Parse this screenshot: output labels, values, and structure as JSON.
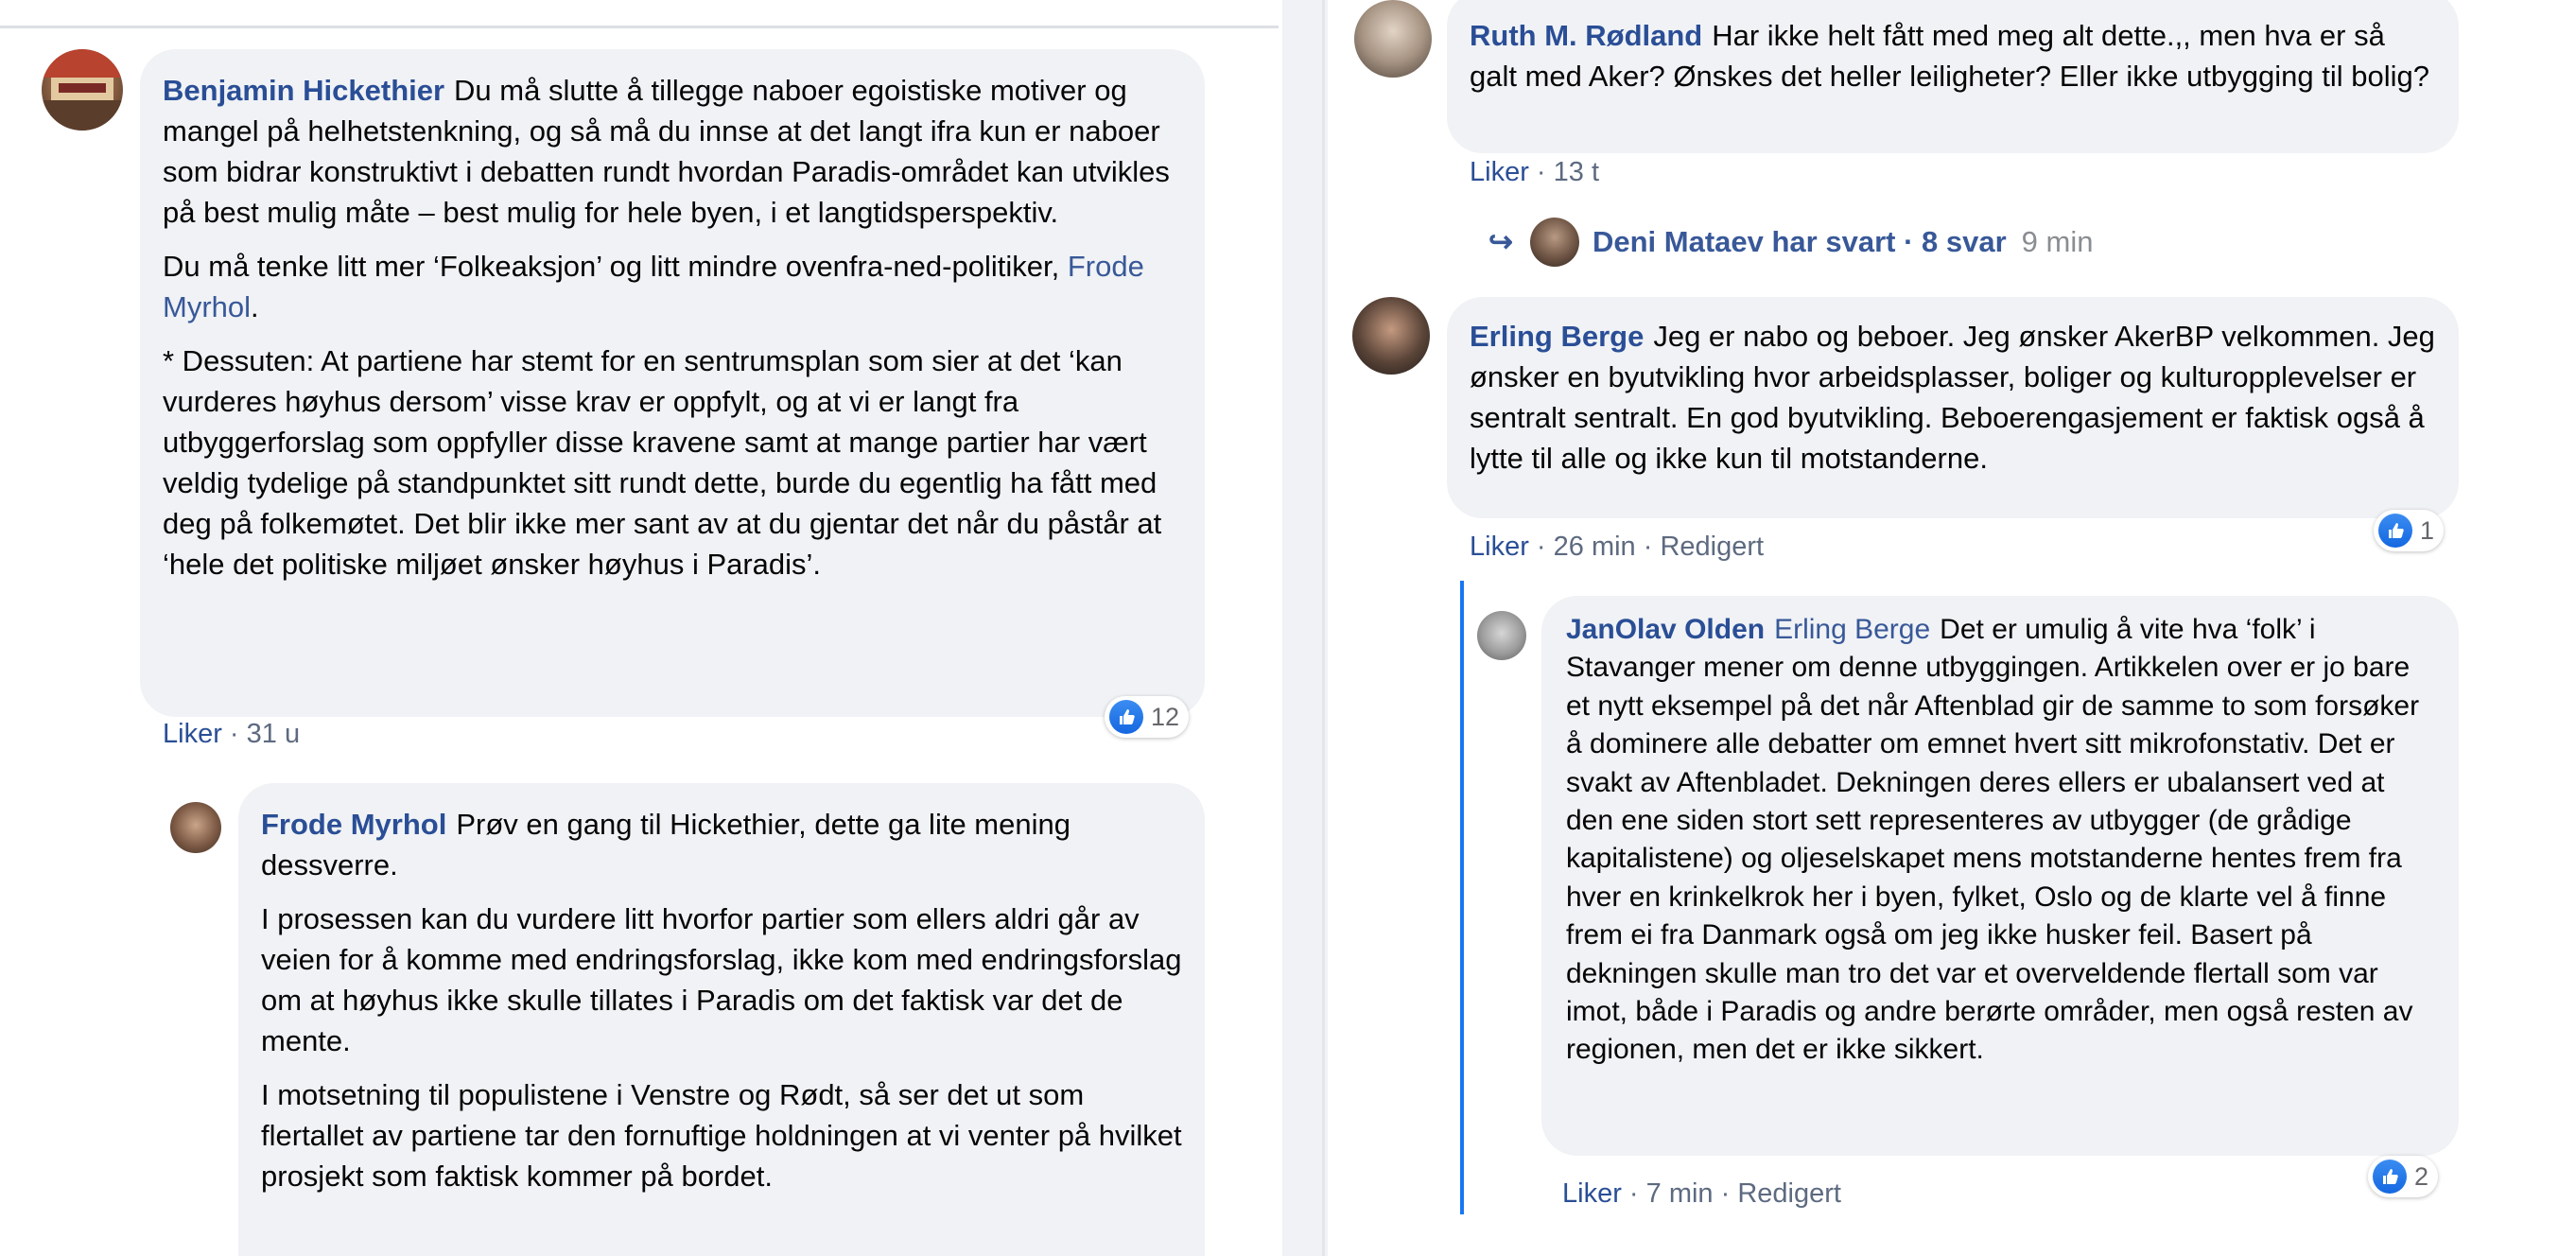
{
  "left": {
    "comment1": {
      "author": "Benjamin Hickethier",
      "para1": "Du må slutte å tillegge naboer egoistiske motiver og mangel på helhetstenkning, og så må du innse at det langt ifra kun er naboer som bidrar konstruktivt i debatten rundt hvordan Paradis-området kan utvikles på best mulig måte – best mulig for hele byen, i et langtidsperspektiv.",
      "para2_before": "Du må tenke litt mer ‘Folkeaksjon’ og litt mindre ovenfra-ned-politiker,",
      "para2_mention": "Frode Myrhol",
      "para2_after": ".",
      "para3": "* Dessuten: At partiene har stemt for en sentrumsplan som sier at det ‘kan vurderes høyhus dersom’ visse krav er oppfylt, og at vi er langt fra utbyggerforslag som oppfyller disse kravene samt at mange partier har vært veldig tydelige på standpunktet sitt rundt dette, burde du egentlig ha fått med deg på folkemøtet. Det blir ikke mer sant av at du gjentar det når du påstår at ‘hele det politiske miljøet ønsker høyhus i Paradis’.",
      "like_label": "Liker",
      "meta": "· 31 u",
      "reaction_count": "12"
    },
    "comment2": {
      "author": "Frode Myrhol",
      "para1": "Prøv en gang til Hickethier, dette ga lite mening dessverre.",
      "para2": "I prosessen kan du vurdere litt hvorfor partier som ellers aldri går av veien for å komme med endringsforslag, ikke kom med endringsforslag om at høyhus ikke skulle tillates i Paradis om det faktisk var det de mente.",
      "para3": "I motsetning til populistene i Venstre og Rødt, så ser det ut som flertallet av partiene tar den fornuftige holdningen at vi venter på hvilket prosjekt som faktisk kommer på bordet."
    }
  },
  "right": {
    "comment1": {
      "author": "Ruth M. Rødland",
      "text": "Har ikke helt fått med meg alt dette.,, men hva er så galt med Aker? Ønskes det heller leiligheter? Eller ikke utbygging til bolig?",
      "like_label": "Liker",
      "meta": "· 13 t"
    },
    "replies": {
      "text": "Deni Mataev har svart · 8 svar",
      "time": "9 min"
    },
    "comment2": {
      "author": "Erling Berge",
      "text": "Jeg er nabo og beboer. Jeg ønsker AkerBP velkommen. Jeg ønsker en byutvikling hvor arbeidsplasser, boliger og kulturopplevelser er sentralt sentralt. En god byutvikling. Beboerengasjement er faktisk også å lytte til alle og ikke kun til motstanderne.",
      "like_label": "Liker",
      "meta": "· 26 min · Redigert",
      "reaction_count": "1"
    },
    "comment3": {
      "author": "JanOlav Olden",
      "mention": "Erling Berge",
      "text": "Det er umulig å vite hva ‘folk’ i Stavanger mener om denne utbyggingen. Artikkelen over er jo bare et nytt eksempel på det når Aftenblad gir de samme to som forsøker å dominere alle debatter om emnet hvert sitt mikrofonstativ. Det er svakt av Aftenbladet. Dekningen deres ellers er ubalansert ved at den ene siden stort sett representeres av utbygger (de grådige kapitalistene) og oljeselskapet mens motstanderne hentes frem fra hver en krinkelkrok her i byen, fylket, Oslo og de klarte vel å finne frem ei fra Danmark også om jeg ikke husker feil. Basert på dekningen skulle man tro det var et overveldende flertall som var imot, både i Paradis og andre berørte områder, men også resten av regionen, men det er ikke sikkert.",
      "like_label": "Liker",
      "meta": "· 7 min · Redigert",
      "reaction_count": "2"
    }
  },
  "colors": {
    "bubble": "#f0f2f5",
    "name": "#2a4e96",
    "link": "#385898",
    "like_blue": "#1877f2"
  }
}
